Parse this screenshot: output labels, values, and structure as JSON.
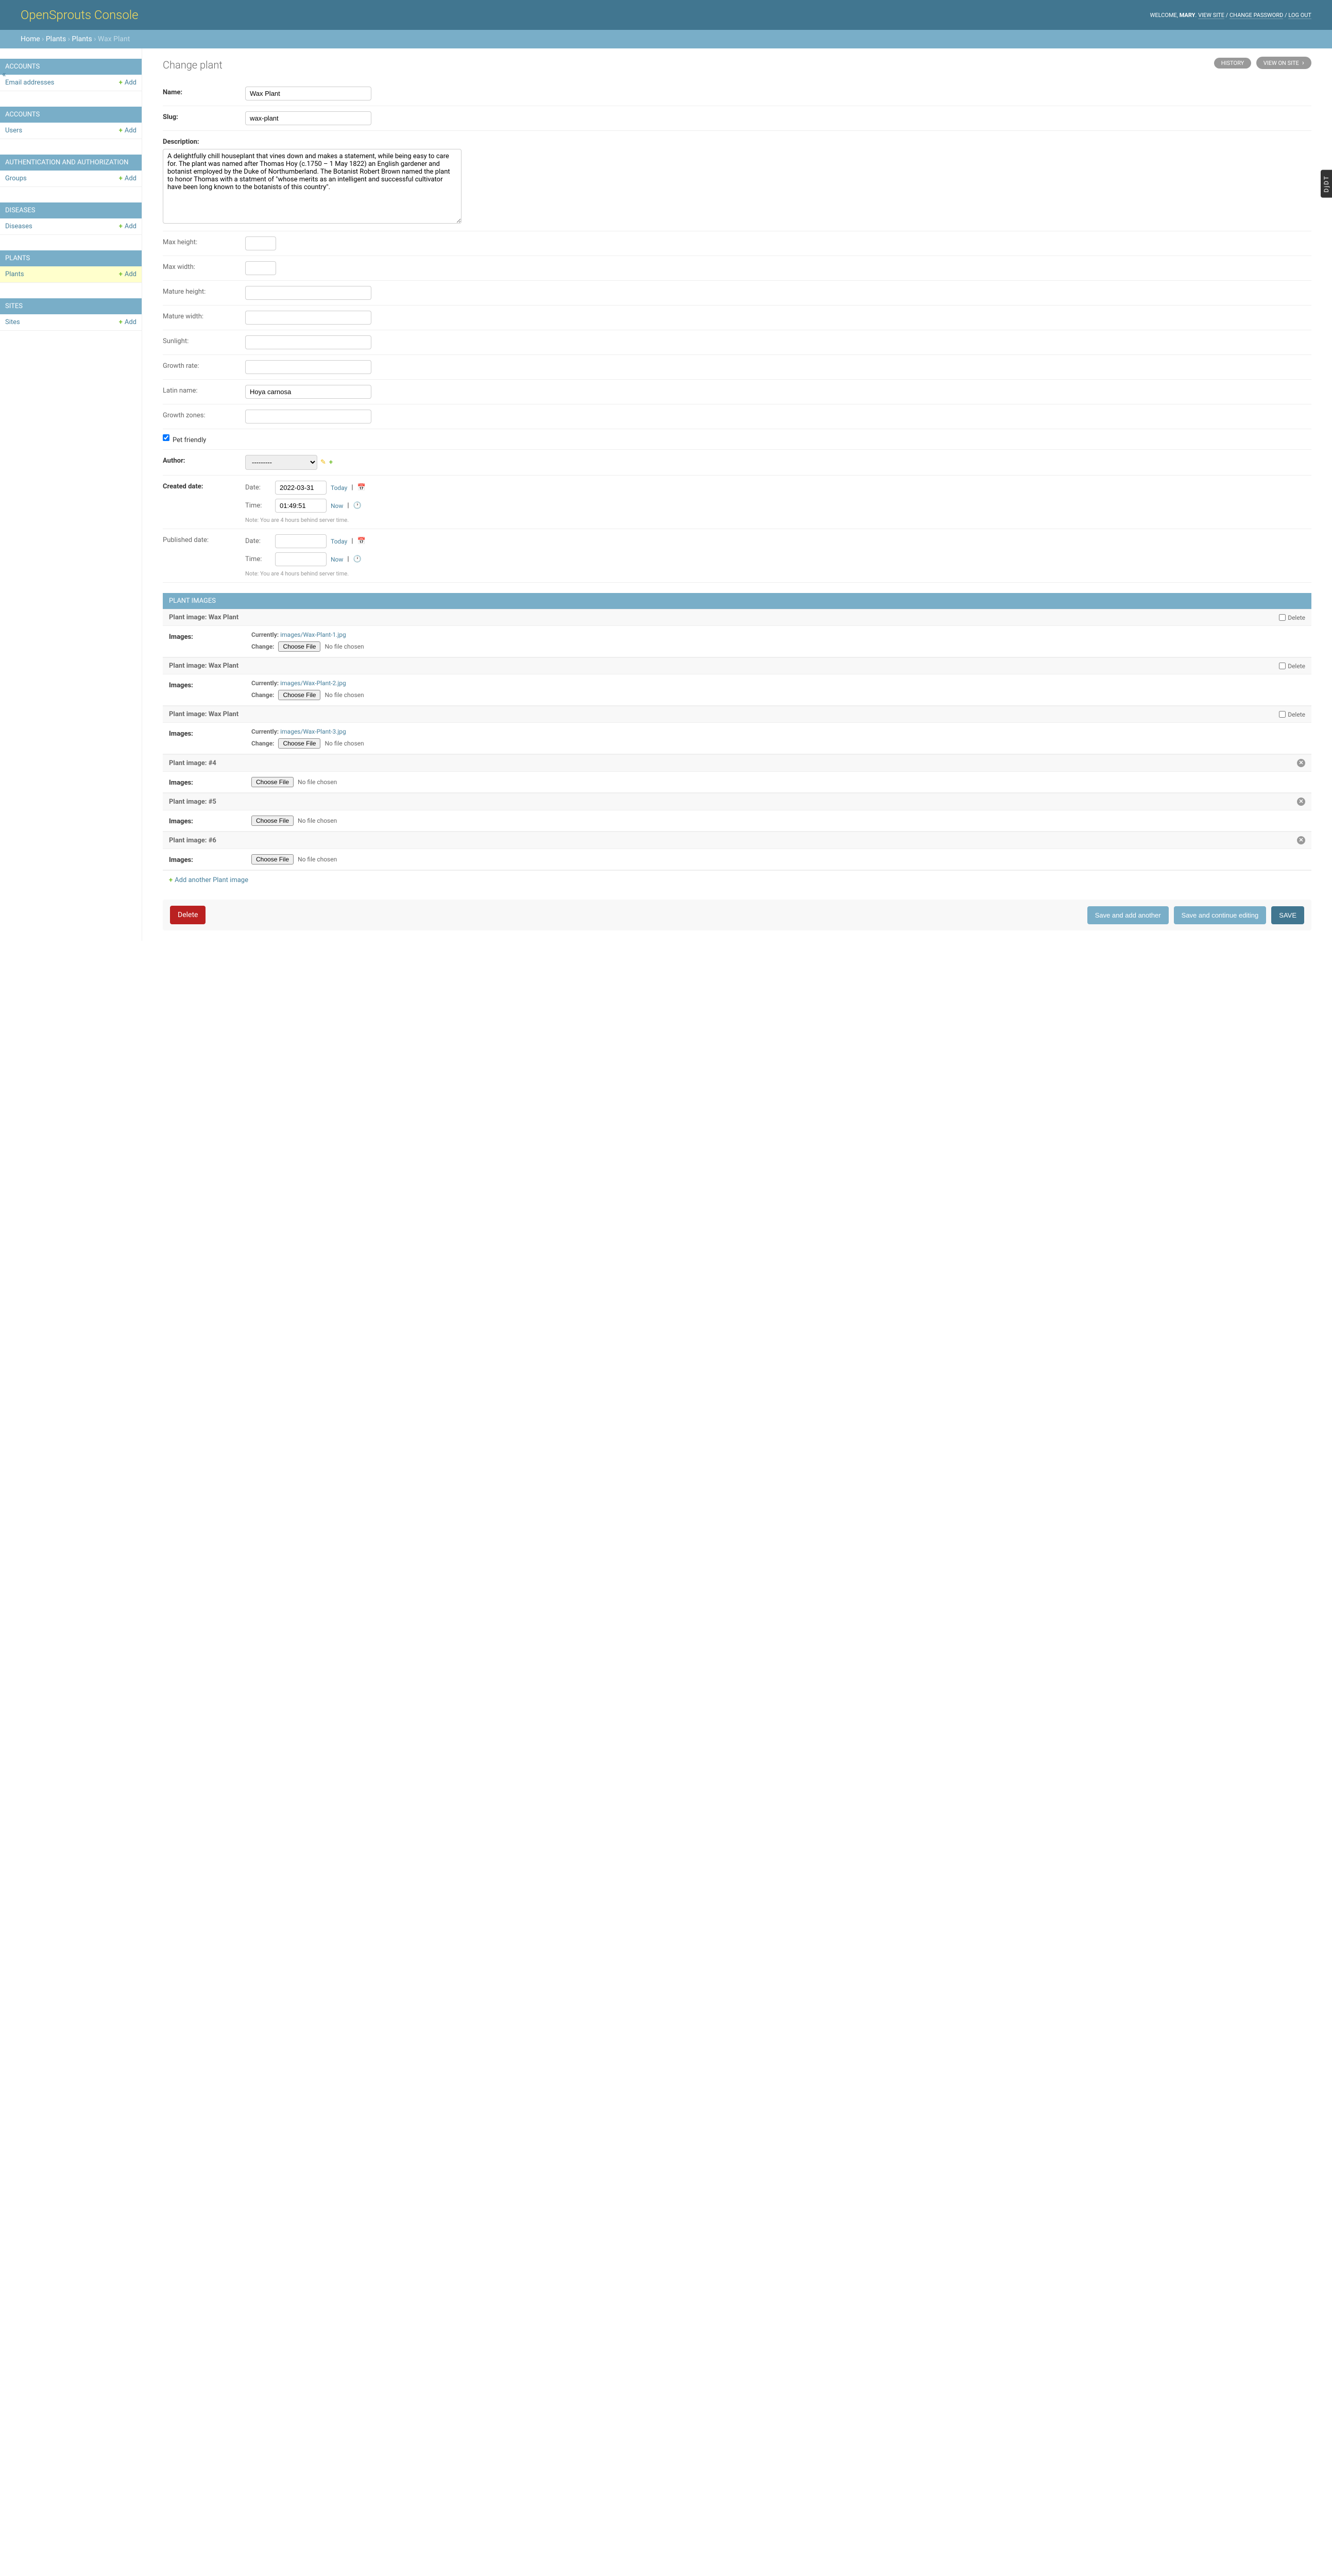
{
  "header": {
    "branding": "OpenSprouts Console",
    "welcome": "WELCOME,",
    "username": "MARY",
    "view_site": "VIEW SITE",
    "change_password": "CHANGE PASSWORD",
    "log_out": "LOG OUT"
  },
  "breadcrumbs": {
    "home": "Home",
    "app": "Plants",
    "model": "Plants",
    "object": "Wax Plant"
  },
  "sidebar": {
    "toggle": "«",
    "apps": [
      {
        "caption": "ACCOUNTS",
        "models": [
          {
            "name": "Email addresses",
            "add": "Add"
          }
        ]
      },
      {
        "caption": "ACCOUNTS",
        "models": [
          {
            "name": "Users",
            "add": "Add"
          }
        ]
      },
      {
        "caption": "AUTHENTICATION AND AUTHORIZATION",
        "models": [
          {
            "name": "Groups",
            "add": "Add"
          }
        ]
      },
      {
        "caption": "DISEASES",
        "models": [
          {
            "name": "Diseases",
            "add": "Add"
          }
        ]
      },
      {
        "caption": "PLANTS",
        "current": true,
        "models": [
          {
            "name": "Plants",
            "add": "Add",
            "current": true
          }
        ]
      },
      {
        "caption": "SITES",
        "models": [
          {
            "name": "Sites",
            "add": "Add"
          }
        ]
      }
    ]
  },
  "page_title": "Change plant",
  "object_tools": {
    "history": "HISTORY",
    "view_on_site": "VIEW ON SITE"
  },
  "form": {
    "labels": {
      "name": "Name:",
      "slug": "Slug:",
      "description": "Description:",
      "max_height": "Max height:",
      "max_width": "Max width:",
      "mature_height": "Mature height:",
      "mature_width": "Mature width:",
      "sunlight": "Sunlight:",
      "growth_rate": "Growth rate:",
      "latin_name": "Latin name:",
      "growth_zones": "Growth zones:",
      "pet_friendly": "Pet friendly",
      "author": "Author:",
      "created_date": "Created date:",
      "published_date": "Published date:",
      "date": "Date:",
      "time": "Time:",
      "today": "Today",
      "now": "Now",
      "tz_note": "Note: You are 4 hours behind server time.",
      "author_blank": "---------"
    },
    "values": {
      "name": "Wax Plant",
      "slug": "wax-plant",
      "description": "A delightfully chill houseplant that vines down and makes a statement, while being easy to care for. The plant was named after Thomas Hoy (c.1750 – 1 May 1822) an English gardener and botanist employed by the Duke of Northumberland. The Botanist Robert Brown named the plant to honor Thomas with a statment of \"whose merits as an intelligent and successful cultivator have been long known to the botanists of this country\".",
      "max_height": "",
      "max_width": "",
      "mature_height": "",
      "mature_width": "",
      "sunlight": "",
      "growth_rate": "",
      "latin_name": "Hoya carnosa",
      "growth_zones": "",
      "pet_friendly": true,
      "created_date": "2022-03-31",
      "created_time": "01:49:51",
      "published_date": "",
      "published_time": ""
    }
  },
  "inlines": {
    "heading": "PLANT IMAGES",
    "labels": {
      "images": "Images:",
      "currently": "Currently:",
      "change": "Change:",
      "choose_file": "Choose File",
      "no_file": "No file chosen",
      "delete": "Delete",
      "add_another": "Add another Plant image"
    },
    "forms": [
      {
        "title": "Plant image: Wax Plant",
        "currently": "images/Wax-Plant-1.jpg",
        "has_file": true,
        "can_delete": true
      },
      {
        "title": "Plant image: Wax Plant",
        "currently": "images/Wax-Plant-2.jpg",
        "has_file": true,
        "can_delete": true
      },
      {
        "title": "Plant image: Wax Plant",
        "currently": "images/Wax-Plant-3.jpg",
        "has_file": true,
        "can_delete": true
      },
      {
        "title": "Plant image: #4",
        "has_file": false,
        "can_delete": false,
        "removable": true
      },
      {
        "title": "Plant image: #5",
        "has_file": false,
        "can_delete": false,
        "removable": true
      },
      {
        "title": "Plant image: #6",
        "has_file": false,
        "can_delete": false,
        "removable": true
      }
    ]
  },
  "submit": {
    "delete": "Delete",
    "save_add": "Save and add another",
    "save_continue": "Save and continue editing",
    "save": "SAVE"
  },
  "djdt": "DjDT"
}
